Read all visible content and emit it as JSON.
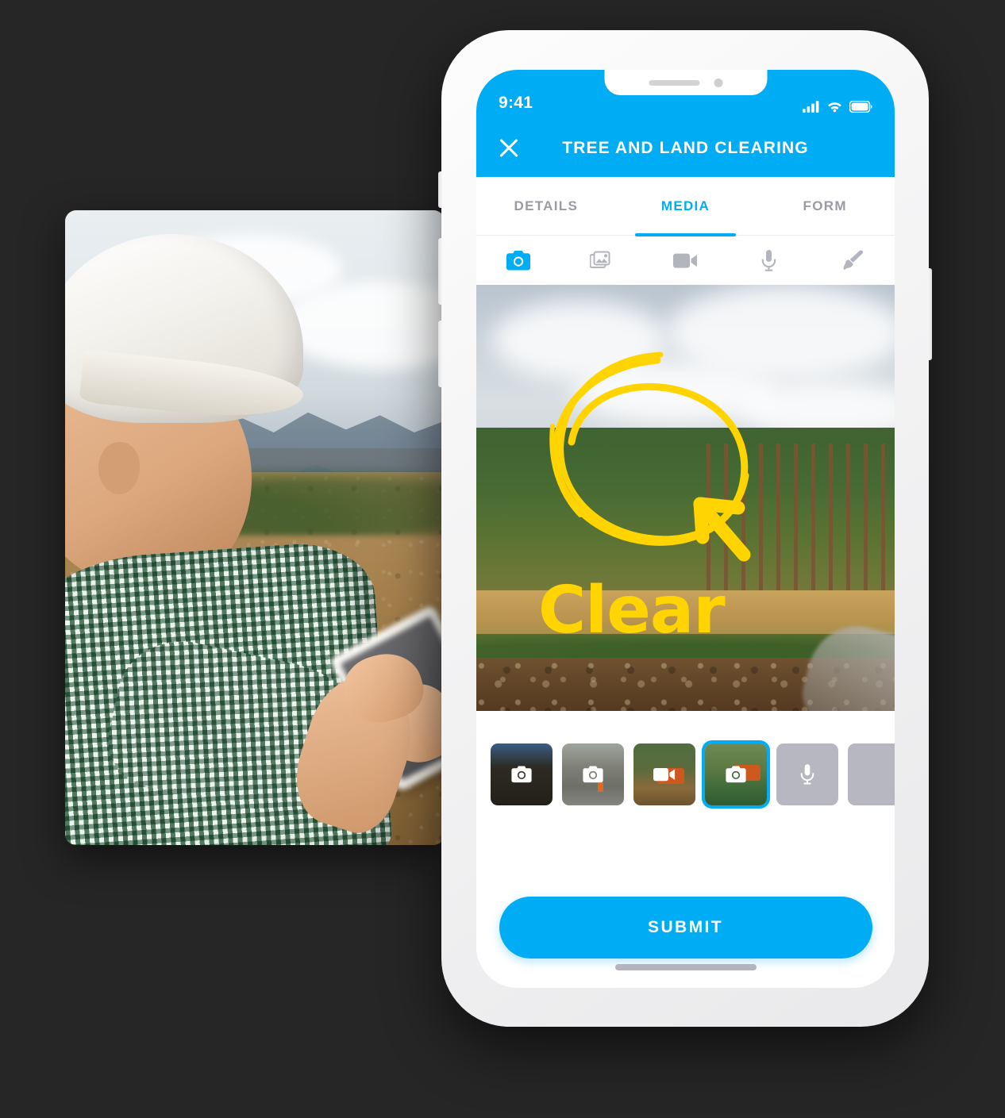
{
  "page": {
    "background_color": "#262626",
    "accent_color": "#00ADF5",
    "annotation_color": "#FFD400"
  },
  "left_photo": {
    "alt": "Construction worker in white hard hat and green checkered shirt using a tablet on a cleared land site with a yellow excavator behind him"
  },
  "phone": {
    "status_bar": {
      "time": "9:41",
      "signal_icon": "cellular-signal-icon",
      "wifi_icon": "wifi-icon",
      "battery_icon": "battery-icon"
    },
    "nav": {
      "close_icon": "close-icon",
      "title": "TREE AND LAND CLEARING"
    },
    "tabs": [
      {
        "label": "DETAILS",
        "active": false
      },
      {
        "label": "MEDIA",
        "active": true
      },
      {
        "label": "FORM",
        "active": false
      }
    ],
    "media_toolbar": [
      {
        "icon": "camera-icon",
        "active": true
      },
      {
        "icon": "photo-library-icon",
        "active": false
      },
      {
        "icon": "video-camera-icon",
        "active": false
      },
      {
        "icon": "microphone-icon",
        "active": false
      },
      {
        "icon": "paintbrush-icon",
        "active": false
      }
    ],
    "preview": {
      "alt": "Aerial view of a pine forest edge with a freshly cleared strip of brown mulched ground",
      "annotations": {
        "circle_icon": "hand-drawn-circle-annotation",
        "arrow_icon": "hand-drawn-arrow-annotation",
        "text": "Clear"
      }
    },
    "thumbnails": [
      {
        "type": "photo",
        "icon": "camera-icon",
        "selected": false
      },
      {
        "type": "photo",
        "icon": "camera-icon",
        "selected": false
      },
      {
        "type": "video",
        "icon": "video-camera-icon",
        "selected": false
      },
      {
        "type": "photo",
        "icon": "camera-icon",
        "selected": true
      },
      {
        "type": "audio",
        "icon": "microphone-icon",
        "selected": false
      },
      {
        "type": "empty",
        "icon": "",
        "selected": false
      }
    ],
    "submit": {
      "label": "SUBMIT"
    },
    "home_indicator": "home-indicator"
  }
}
